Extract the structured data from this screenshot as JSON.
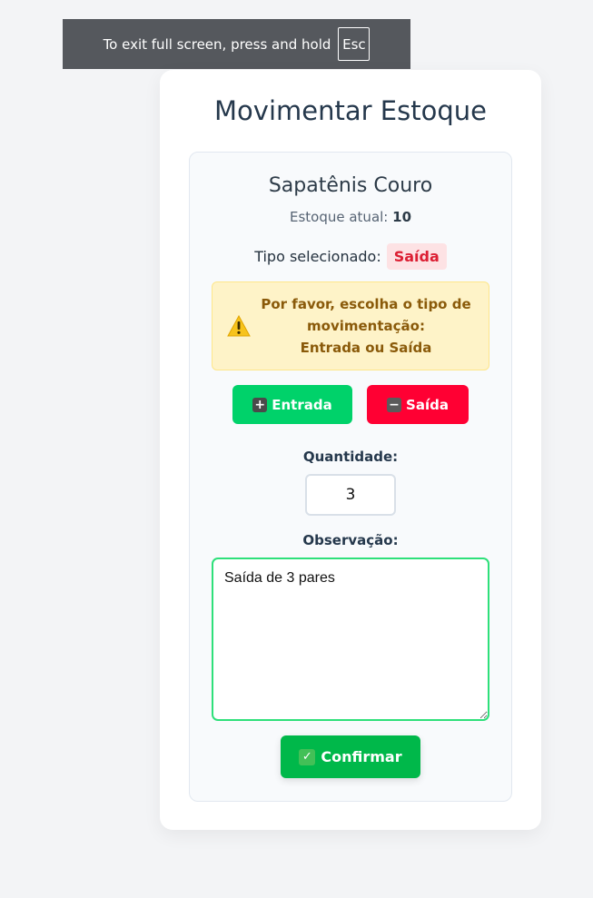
{
  "fullscreen_notice": {
    "text": "To exit full screen, press and hold",
    "key": "Esc"
  },
  "page": {
    "title": "Movimentar Estoque"
  },
  "product": {
    "name": "Sapatênis Couro",
    "stock_label": "Estoque atual:",
    "stock_value": "10"
  },
  "type": {
    "label": "Tipo selecionado:",
    "value": "Saída"
  },
  "warning": {
    "icon": "warning-icon",
    "line1": "Por favor, escolha o tipo de",
    "line2": "movimentação:",
    "line3": "Entrada ou Saída"
  },
  "buttons": {
    "entrada_label": "Entrada",
    "entrada_icon": "plus-icon",
    "saida_label": "Saída",
    "saida_icon": "minus-icon",
    "confirm_label": "Confirmar",
    "confirm_icon": "check-icon"
  },
  "form": {
    "quantity_label": "Quantidade:",
    "quantity_value": "3",
    "observation_label": "Observação:",
    "observation_value": "Saída de 3 pares"
  },
  "colors": {
    "entrada": "#00d26a",
    "saida": "#ff0033",
    "confirm": "#00b84a",
    "badge_text": "#dc1f33",
    "badge_bg": "#fde2e4",
    "warning_bg": "#fef3c8",
    "warning_text": "#8a5a0a",
    "focus_border": "#2ee07a"
  }
}
